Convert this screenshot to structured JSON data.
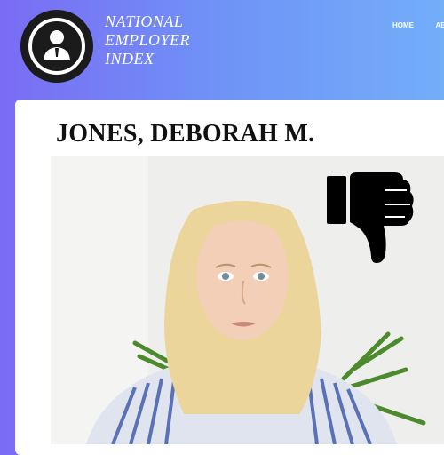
{
  "brand": {
    "line1": "NATIONAL",
    "line2": "EMPLOYER",
    "line3": "INDEX",
    "logo_icon": "employee-cycle-icon"
  },
  "nav": {
    "items": [
      {
        "label": "HOME"
      },
      {
        "label": "AB"
      }
    ]
  },
  "profile": {
    "name": "JONES, DEBORAH M.",
    "rating_icon": "thumbs-down-icon"
  },
  "colors": {
    "header_gradient_start": "#7a6cf4",
    "header_gradient_end": "#73aef9",
    "card_bg": "#ffffff",
    "text_dark": "#111111",
    "icon_black": "#000000"
  }
}
